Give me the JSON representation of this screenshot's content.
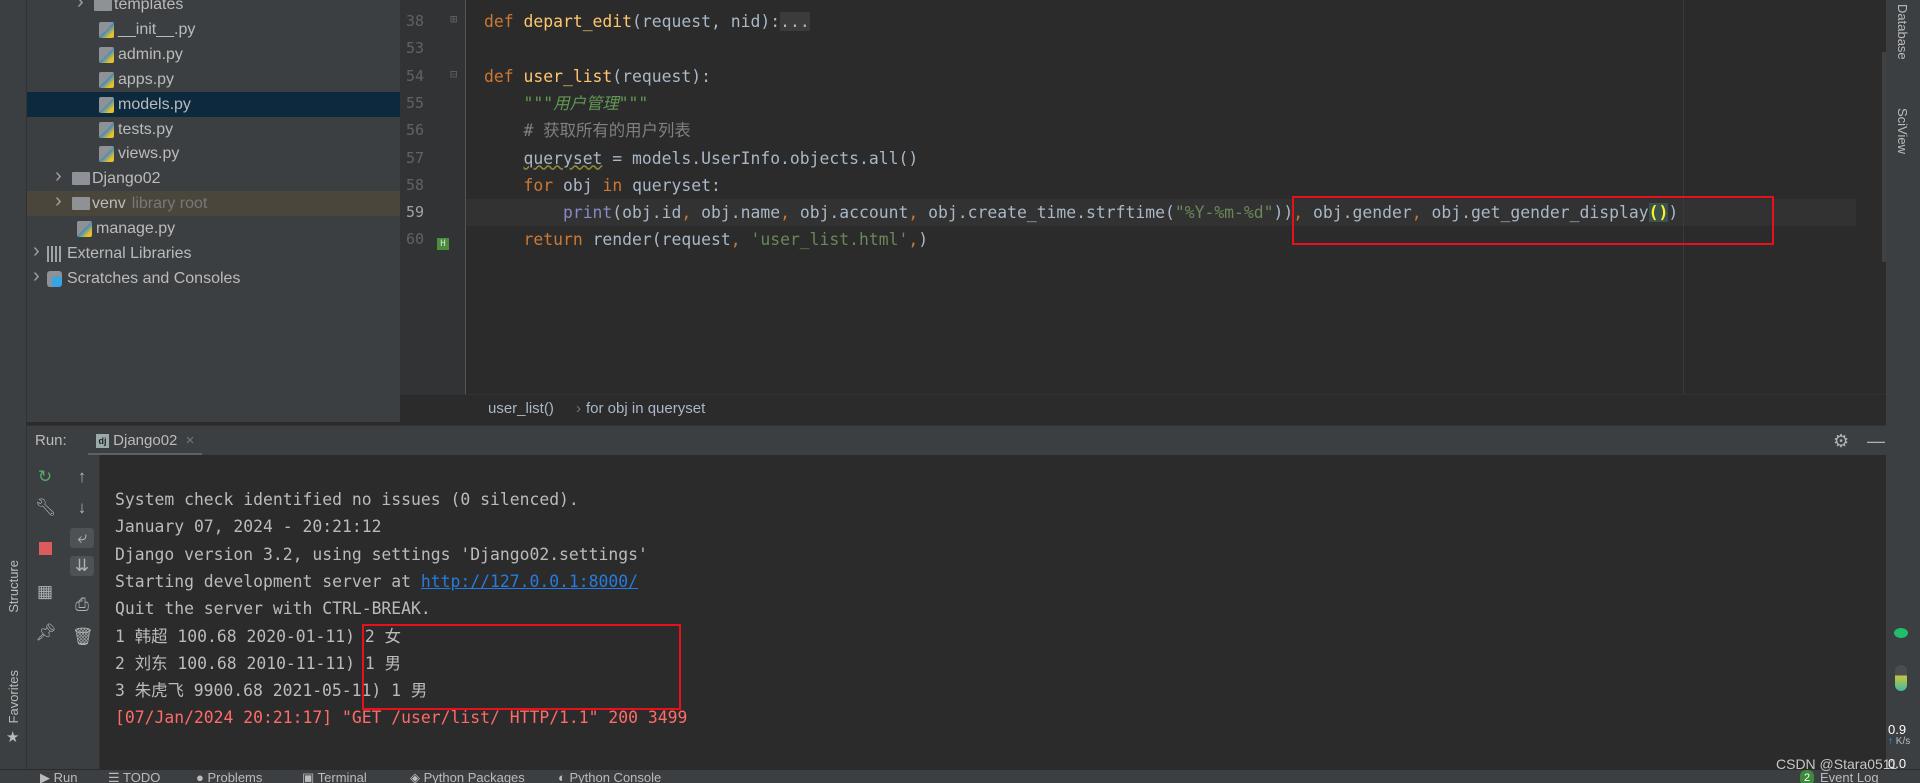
{
  "project_tree": [
    {
      "label": "templates",
      "kind": "folder",
      "level": 3,
      "arrow": true
    },
    {
      "label": "__init__.py",
      "kind": "py",
      "level": 4
    },
    {
      "label": "admin.py",
      "kind": "py",
      "level": 4
    },
    {
      "label": "apps.py",
      "kind": "py",
      "level": 4
    },
    {
      "label": "models.py",
      "kind": "py",
      "level": 4,
      "selected": true
    },
    {
      "label": "tests.py",
      "kind": "py",
      "level": 4
    },
    {
      "label": "views.py",
      "kind": "py",
      "level": 4
    },
    {
      "label": "Django02",
      "kind": "folder",
      "level": 2,
      "arrow": true
    },
    {
      "label": "venv",
      "hint": "library root",
      "kind": "folder",
      "level": 2,
      "arrow": true,
      "library": true
    },
    {
      "label": "manage.py",
      "kind": "py",
      "level": 3
    },
    {
      "label": "External Libraries",
      "kind": "libs",
      "level": 1,
      "arrow": true
    },
    {
      "label": "Scratches and Consoles",
      "kind": "scratch",
      "level": 1,
      "arrow": true
    }
  ],
  "editor": {
    "lines": [
      {
        "num": "38",
        "tokens": [
          [
            "kw",
            "def "
          ],
          [
            "fn",
            "depart_edit"
          ],
          [
            "",
            "(request, nid):"
          ],
          [
            "fold",
            "..."
          ]
        ]
      },
      {
        "num": "53",
        "tokens": []
      },
      {
        "num": "54",
        "tokens": [
          [
            "kw",
            "def "
          ],
          [
            "fn",
            "user_list"
          ],
          [
            "",
            "(request):"
          ]
        ]
      },
      {
        "num": "55",
        "tokens": [
          [
            "",
            "    "
          ],
          [
            "doc",
            "\"\"\"用户管理\"\"\""
          ]
        ]
      },
      {
        "num": "56",
        "tokens": [
          [
            "",
            "    "
          ],
          [
            "cm",
            "# 获取所有的用户列表"
          ]
        ]
      },
      {
        "num": "57",
        "tokens": [
          [
            "",
            "    "
          ],
          [
            "warn",
            "queryset"
          ],
          [
            "",
            " = models.UserInfo.objects.all()"
          ]
        ]
      },
      {
        "num": "58",
        "tokens": [
          [
            "",
            "    "
          ],
          [
            "kw",
            "for "
          ],
          [
            "",
            "obj "
          ],
          [
            "kw",
            "in "
          ],
          [
            "",
            "queryset:"
          ]
        ]
      },
      {
        "num": "59",
        "current": true,
        "tokens": [
          [
            "",
            "        "
          ],
          [
            "bi",
            "print"
          ],
          [
            "",
            "(obj.id"
          ],
          [
            "kw",
            ", "
          ],
          [
            "",
            "obj.name"
          ],
          [
            "kw",
            ", "
          ],
          [
            "",
            "obj.account"
          ],
          [
            "kw",
            ", "
          ],
          [
            "",
            "obj.create_time.strftime("
          ],
          [
            "str",
            "\"%Y-%m-%d\""
          ],
          [
            "",
            "))"
          ],
          [
            "kw",
            ", "
          ],
          [
            "",
            "obj.gender"
          ],
          [
            "kw",
            ", "
          ],
          [
            "",
            "obj.get_gender_display"
          ],
          [
            "brk",
            "()"
          ],
          [
            "",
            ")"
          ]
        ]
      },
      {
        "num": "60",
        "tokens": [
          [
            "",
            "    "
          ],
          [
            "kw",
            "return "
          ],
          [
            "",
            "render(request"
          ],
          [
            "kw",
            ", "
          ],
          [
            "str",
            "'user_list.html'"
          ],
          [
            "kw",
            ","
          ],
          [
            "",
            ")"
          ]
        ]
      }
    ],
    "breadcrumb": [
      "user_list()",
      "for obj in queryset"
    ]
  },
  "run": {
    "label": "Run:",
    "tab": "Django02",
    "console": [
      {
        "text": "System check identified no issues (0 silenced)."
      },
      {
        "text": "January 07, 2024 - 20:21:12"
      },
      {
        "text": "Django version 3.2, using settings 'Django02.settings'"
      },
      {
        "text": "Starting development server at ",
        "link": "http://127.0.0.1:8000/"
      },
      {
        "text": "Quit the server with CTRL-BREAK."
      },
      {
        "text": "1 韩超 100.68 2020-01-11) 2 女"
      },
      {
        "text": "2 刘东 100.68 2010-11-11) 1 男"
      },
      {
        "text": "3 朱虎飞 9900.68 2021-05-11) 1 男"
      },
      {
        "text": "[07/Jan/2024 20:21:17] \"GET /user/list/ HTTP/1.1\" 200 3499",
        "error": true
      }
    ]
  },
  "left_stripe": [
    "Structure",
    "Favorites"
  ],
  "right_stripe": [
    "Database",
    "SciView"
  ],
  "network": {
    "up": "0.9",
    "down": "0.0",
    "unit": "K/s"
  },
  "bottom_tabs": [
    "Run",
    "TODO",
    "Problems",
    "Terminal",
    "Python Packages",
    "Python Console"
  ],
  "event_log": {
    "label": "Event Log",
    "badge": "2"
  },
  "watermark": "CSDN @Stara0511",
  "colors": {
    "highlight_box": "#e8101a",
    "selection": "#0d293e",
    "link": "#287bde",
    "error": "#ff6b68"
  }
}
